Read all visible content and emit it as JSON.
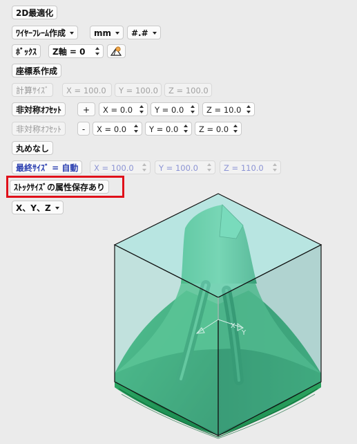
{
  "toolbar": {
    "optimize_2d": "2D最適化",
    "wireframe": "ﾜｲﾔｰﾌﾚｰﾑ作成",
    "unit": "mm",
    "format": "#.#",
    "box": "ﾎﾞｯｸｽ",
    "z_axis": "Z軸 = 0",
    "create_cs": "座標系作成",
    "calc_size": "計算ｻｲｽﾞ",
    "calc_x": "X = 100.0",
    "calc_y": "Y = 100.0",
    "calc_z": "Z = 100.0",
    "asym_offset_1": "非対称ｵﾌｾｯﾄ",
    "plus": "+",
    "off1_x": "X = 0.0",
    "off1_y": "Y = 0.0",
    "off1_z": "Z = 10.0",
    "asym_offset_2": "非対称ｵﾌｾｯﾄ",
    "minus": "-",
    "off2_x": "X = 0.0",
    "off2_y": "Y = 0.0",
    "off2_z": "Z = 0.0",
    "no_round": "丸めなし",
    "final_size": "最終ｻｲｽﾞ = 自動",
    "final_x": "X = 100.0",
    "final_y": "Y = 100.0",
    "final_z": "Z = 110.0",
    "stock_attr": "ｽﾄｯｸｻｲｽﾞの属性保存あり",
    "axes": "X、Y、Z"
  },
  "model": {
    "axis_label_x": "X",
    "axis_label_y": "Y",
    "box_color": "#7fd1c8",
    "part_color": "#2fae66"
  }
}
